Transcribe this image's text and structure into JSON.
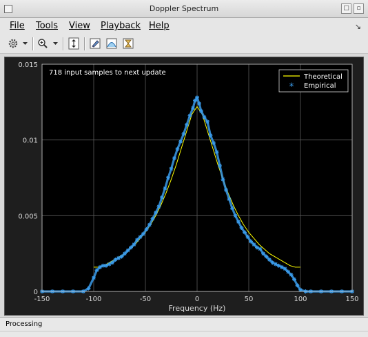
{
  "window": {
    "title": "Doppler Spectrum"
  },
  "menu": [
    {
      "id": "file",
      "label": "File"
    },
    {
      "id": "tools",
      "label": "Tools"
    },
    {
      "id": "view",
      "label": "View"
    },
    {
      "id": "playback",
      "label": "Playback"
    },
    {
      "id": "help",
      "label": "Help"
    }
  ],
  "toolbar": [
    "settings-icon",
    "dropdown-arrow-icon",
    "zoom-in-icon",
    "dropdown-arrow-icon",
    "scale-axes-icon",
    "edit-properties-icon",
    "spectrum-icon",
    "hourglass-icon"
  ],
  "status": {
    "text": "Processing"
  },
  "plot": {
    "annotation": "718 input samples to next update",
    "legend": {
      "theoretical": "Theoretical",
      "empirical": "Empirical"
    },
    "colors": {
      "theoretical": "#ffff00",
      "empirical": "#3a9ae8",
      "background": "#000000",
      "grid": "#5a5a5a"
    }
  },
  "chart_data": {
    "type": "line",
    "title": "",
    "xlabel": "Frequency (Hz)",
    "ylabel": "",
    "xlim": [
      -150,
      150
    ],
    "ylim": [
      0,
      0.015
    ],
    "grid": true,
    "legend_placement": "top-right",
    "xticks": [
      "-150",
      "-100",
      "-50",
      "0",
      "50",
      "100",
      "150"
    ],
    "yticks": [
      "0",
      "0.005",
      "0.01",
      "0.015"
    ],
    "series": [
      {
        "name": "Theoretical",
        "style": "line",
        "x": [
          -100,
          -95,
          -90,
          -85,
          -80,
          -75,
          -70,
          -65,
          -60,
          -55,
          -50,
          -45,
          -40,
          -35,
          -30,
          -25,
          -20,
          -15,
          -10,
          -5,
          0,
          5,
          10,
          15,
          20,
          25,
          30,
          35,
          40,
          45,
          50,
          55,
          60,
          65,
          70,
          75,
          80,
          85,
          90,
          95,
          100
        ],
        "y": [
          0.0016,
          0.0016,
          0.0017,
          0.0019,
          0.0021,
          0.0023,
          0.0025,
          0.0028,
          0.0031,
          0.0035,
          0.0039,
          0.0044,
          0.005,
          0.0057,
          0.0065,
          0.0074,
          0.0084,
          0.0095,
          0.0106,
          0.0117,
          0.0122,
          0.0117,
          0.0106,
          0.0095,
          0.0084,
          0.0074,
          0.0065,
          0.0057,
          0.005,
          0.0044,
          0.0039,
          0.0035,
          0.0031,
          0.0028,
          0.0025,
          0.0023,
          0.0021,
          0.0019,
          0.0017,
          0.0016,
          0.0016
        ]
      },
      {
        "name": "Empirical",
        "style": "markers",
        "x": [
          -150,
          -140,
          -130,
          -120,
          -110,
          -105,
          -100,
          -97,
          -94,
          -91,
          -88,
          -85,
          -82,
          -79,
          -76,
          -73,
          -70,
          -67,
          -64,
          -61,
          -58,
          -55,
          -52,
          -49,
          -46,
          -43,
          -40,
          -37,
          -34,
          -31,
          -28,
          -25,
          -22,
          -19,
          -16,
          -13,
          -10,
          -7,
          -4,
          -2,
          0,
          2,
          4,
          7,
          10,
          13,
          16,
          19,
          22,
          25,
          28,
          31,
          34,
          37,
          40,
          43,
          46,
          49,
          52,
          55,
          58,
          61,
          64,
          67,
          70,
          73,
          76,
          79,
          82,
          85,
          88,
          91,
          94,
          97,
          100,
          105,
          110,
          120,
          130,
          140,
          150
        ],
        "y": [
          0,
          0,
          0,
          0,
          0,
          0.0002,
          0.0009,
          0.0014,
          0.0016,
          0.0017,
          0.0017,
          0.0018,
          0.0019,
          0.0021,
          0.0022,
          0.0023,
          0.0025,
          0.0027,
          0.0029,
          0.0031,
          0.0034,
          0.0036,
          0.0038,
          0.0041,
          0.0044,
          0.0048,
          0.0052,
          0.0056,
          0.0062,
          0.0068,
          0.0075,
          0.0081,
          0.0088,
          0.0094,
          0.0099,
          0.0104,
          0.011,
          0.0116,
          0.0121,
          0.0126,
          0.0128,
          0.0124,
          0.0119,
          0.0115,
          0.0112,
          0.0103,
          0.0098,
          0.0092,
          0.0083,
          0.0074,
          0.0067,
          0.0061,
          0.0055,
          0.005,
          0.0046,
          0.0042,
          0.0039,
          0.0036,
          0.0033,
          0.0031,
          0.0029,
          0.0028,
          0.0025,
          0.0023,
          0.0021,
          0.0019,
          0.0018,
          0.0017,
          0.0016,
          0.0015,
          0.0013,
          0.0011,
          0.0008,
          0.0004,
          0.0001,
          0,
          0,
          0,
          0,
          0,
          0
        ]
      }
    ]
  }
}
